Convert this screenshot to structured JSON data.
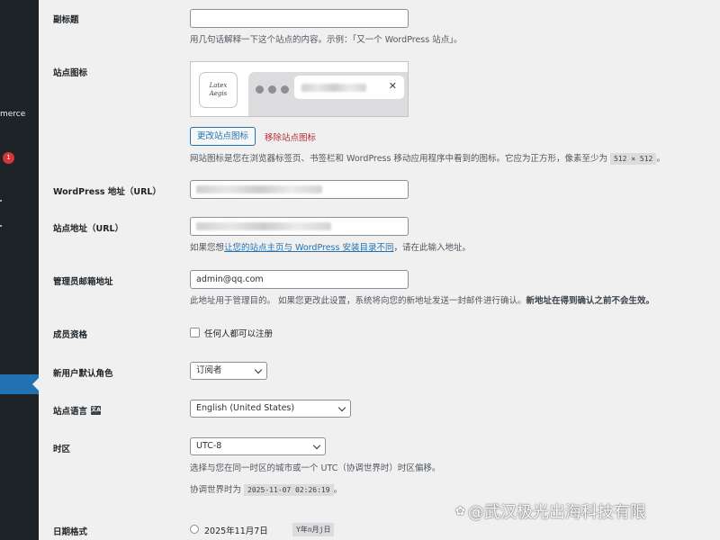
{
  "sidebar": {
    "partial_item": "merce",
    "badge_count": "1",
    "accent": "#2271b1"
  },
  "tagline": {
    "label": "副标题",
    "value": "",
    "description": "用几句话解释一下这个站点的内容。示例：「又一个 WordPress 站点」。"
  },
  "site_icon": {
    "label": "站点图标",
    "logo_text": "Latex Aegis",
    "close_glyph": "✕",
    "change_button": "更改站点图标",
    "remove_link": "移除站点图标",
    "description_prefix": "网站图标是您在浏览器标签页、书签栏和 WordPress 移动应用程序中看到的图标。它应为正方形，像素至少为",
    "size_code": "512 × 512",
    "description_suffix": "。"
  },
  "wp_address": {
    "label": "WordPress 地址（URL）"
  },
  "site_address": {
    "label": "站点地址（URL）",
    "help_prefix": "如果您想",
    "help_link": "让您的站点主页与 WordPress 安装目录不同",
    "help_suffix": "，请在此输入地址。"
  },
  "admin_email": {
    "label": "管理员邮箱地址",
    "value": "admin@qq.com",
    "description": "此地址用于管理目的。 如果您更改此设置，系统将向您的新地址发送一封邮件进行确认。",
    "description_bold": "新地址在得到确认之前不会生效。"
  },
  "membership": {
    "label": "成员资格",
    "checkbox_label": "任何人都可以注册"
  },
  "default_role": {
    "label": "新用户默认角色",
    "selected": "订阅者"
  },
  "site_language": {
    "label": "站点语言",
    "icon_glyph": "文A",
    "selected": "English (United States)"
  },
  "timezone": {
    "label": "时区",
    "selected": "UTC-8",
    "description": "选择与您在同一时区的城市或一个 UTC（协调世界时）时区偏移。",
    "utc_prefix": "协调世界时为",
    "utc_time": "2025-11-07 02:26:19",
    "utc_suffix": "。"
  },
  "date_format": {
    "label": "日期格式",
    "option1_label": "2025年11月7日",
    "option1_code": "Y年n月j日"
  },
  "watermark": {
    "icon": "✿",
    "text": "@武汉极光出海科技有限"
  }
}
